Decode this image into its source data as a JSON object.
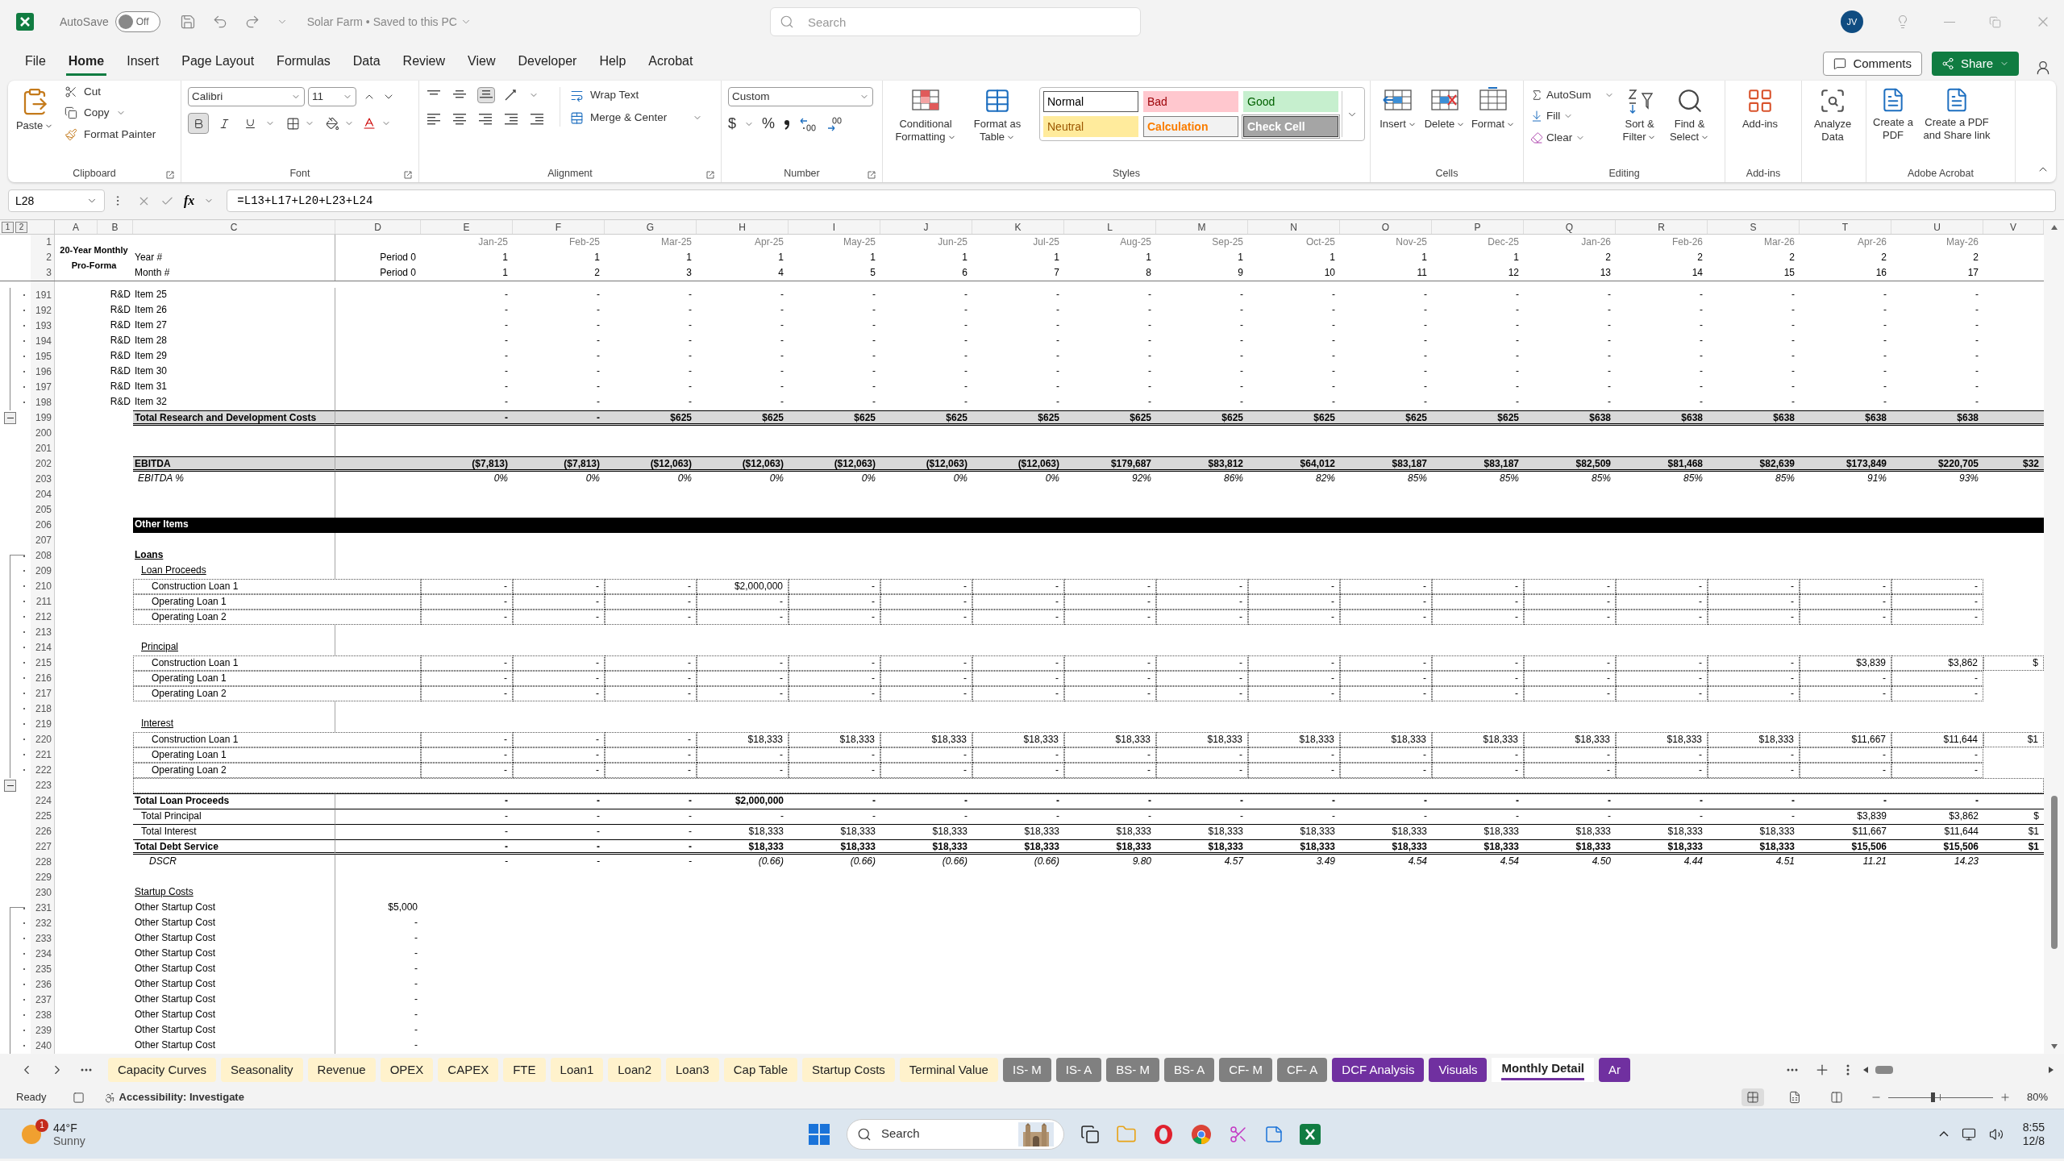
{
  "title_bar": {
    "autosave": {
      "label": "AutoSave",
      "state_text": "Off",
      "on": false
    },
    "document": "Solar Farm • Saved to this PC",
    "search": {
      "placeholder": "Search"
    },
    "avatar": "JV"
  },
  "menu": {
    "tabs": [
      {
        "label": "File",
        "selected": false
      },
      {
        "label": "Home",
        "selected": true
      },
      {
        "label": "Insert",
        "selected": false
      },
      {
        "label": "Page Layout",
        "selected": false
      },
      {
        "label": "Formulas",
        "selected": false
      },
      {
        "label": "Data",
        "selected": false
      },
      {
        "label": "Review",
        "selected": false
      },
      {
        "label": "View",
        "selected": false
      },
      {
        "label": "Developer",
        "selected": false
      },
      {
        "label": "Help",
        "selected": false
      },
      {
        "label": "Acrobat",
        "selected": false
      }
    ],
    "comments": "Comments",
    "share": "Share"
  },
  "ribbon": {
    "clipboard": {
      "label": "Clipboard",
      "paste": "Paste",
      "cut": "Cut",
      "copy": "Copy",
      "format_painter": "Format Painter"
    },
    "font": {
      "label": "Font",
      "family": "Calibri",
      "size": "11",
      "bold": true,
      "italic": false,
      "underline": false
    },
    "alignment": {
      "label": "Alignment",
      "wrap": "Wrap Text",
      "merge": "Merge & Center"
    },
    "number": {
      "label": "Number",
      "format": "Custom",
      "currency": "$",
      "percent": "%"
    },
    "styles": {
      "label": "Styles",
      "conditional": "Conditional Formatting",
      "format_table": "Format as Table",
      "cells": [
        {
          "label": "Normal",
          "kind": "normal"
        },
        {
          "label": "Bad",
          "kind": "bad"
        },
        {
          "label": "Good",
          "kind": "good"
        },
        {
          "label": "Neutral",
          "kind": "neutral"
        },
        {
          "label": "Calculation",
          "kind": "calculation"
        },
        {
          "label": "Check Cell",
          "kind": "check"
        }
      ]
    },
    "cells": {
      "label": "Cells",
      "insert": "Insert",
      "delete": "Delete",
      "format": "Format"
    },
    "editing": {
      "label": "Editing",
      "autosum": "AutoSum",
      "fill": "Fill",
      "clear": "Clear",
      "sort": "Sort & Filter",
      "find": "Find & Select"
    },
    "addins": {
      "label": "Add-ins",
      "button": "Add-ins"
    },
    "analyze": {
      "button": "Analyze Data"
    },
    "acrobat": {
      "label": "Adobe Acrobat",
      "create": "Create a PDF",
      "share": "Create a PDF and Share link"
    }
  },
  "formula_bar": {
    "name_box": "L28",
    "fx": "fx",
    "formula": "=L13+L17+L20+L23+L24"
  },
  "sheet": {
    "outline_levels": [
      "1",
      "2"
    ],
    "columns": [
      "A",
      "B",
      "C",
      "D",
      "E",
      "F",
      "G",
      "H",
      "I",
      "J",
      "K",
      "L",
      "M",
      "N",
      "O",
      "P",
      "Q",
      "R",
      "S",
      "T",
      "U",
      "V"
    ],
    "title": "20-Year Monthly Pro-Forma",
    "header_rows": [
      {
        "num": "1",
        "v": [
          "Jan-25",
          "Feb-25",
          "Mar-25",
          "Apr-25",
          "May-25",
          "Jun-25",
          "Jul-25",
          "Aug-25",
          "Sep-25",
          "Oct-25",
          "Nov-25",
          "Dec-25",
          "Jan-26",
          "Feb-26",
          "Mar-26",
          "Apr-26",
          "May-26"
        ]
      },
      {
        "num": "2",
        "label": "Year #",
        "d": "Period 0",
        "v": [
          "1",
          "1",
          "1",
          "1",
          "1",
          "1",
          "1",
          "1",
          "1",
          "1",
          "1",
          "1",
          "2",
          "2",
          "2",
          "2",
          "2"
        ]
      },
      {
        "num": "3",
        "label": "Month #",
        "d": "Period 0",
        "v": [
          "1",
          "2",
          "3",
          "4",
          "5",
          "6",
          "7",
          "8",
          "9",
          "10",
          "11",
          "12",
          "13",
          "14",
          "15",
          "16",
          "17"
        ]
      }
    ],
    "rows": [
      {
        "num": "191",
        "kind": "item",
        "grouped": true,
        "b": "R&D",
        "c": "Item 25",
        "v": [
          "-",
          "-",
          "-",
          "-",
          "-",
          "-",
          "-",
          "-",
          "-",
          "-",
          "-",
          "-",
          "-",
          "-",
          "-",
          "-",
          "-"
        ]
      },
      {
        "num": "192",
        "kind": "item",
        "grouped": true,
        "b": "R&D",
        "c": "Item 26",
        "v": [
          "-",
          "-",
          "-",
          "-",
          "-",
          "-",
          "-",
          "-",
          "-",
          "-",
          "-",
          "-",
          "-",
          "-",
          "-",
          "-",
          "-"
        ]
      },
      {
        "num": "193",
        "kind": "item",
        "grouped": true,
        "b": "R&D",
        "c": "Item 27",
        "v": [
          "-",
          "-",
          "-",
          "-",
          "-",
          "-",
          "-",
          "-",
          "-",
          "-",
          "-",
          "-",
          "-",
          "-",
          "-",
          "-",
          "-"
        ]
      },
      {
        "num": "194",
        "kind": "item",
        "grouped": true,
        "b": "R&D",
        "c": "Item 28",
        "v": [
          "-",
          "-",
          "-",
          "-",
          "-",
          "-",
          "-",
          "-",
          "-",
          "-",
          "-",
          "-",
          "-",
          "-",
          "-",
          "-",
          "-"
        ]
      },
      {
        "num": "195",
        "kind": "item",
        "grouped": true,
        "b": "R&D",
        "c": "Item 29",
        "v": [
          "-",
          "-",
          "-",
          "-",
          "-",
          "-",
          "-",
          "-",
          "-",
          "-",
          "-",
          "-",
          "-",
          "-",
          "-",
          "-",
          "-"
        ]
      },
      {
        "num": "196",
        "kind": "item",
        "grouped": true,
        "b": "R&D",
        "c": "Item 30",
        "v": [
          "-",
          "-",
          "-",
          "-",
          "-",
          "-",
          "-",
          "-",
          "-",
          "-",
          "-",
          "-",
          "-",
          "-",
          "-",
          "-",
          "-"
        ]
      },
      {
        "num": "197",
        "kind": "item",
        "grouped": true,
        "b": "R&D",
        "c": "Item 31",
        "v": [
          "-",
          "-",
          "-",
          "-",
          "-",
          "-",
          "-",
          "-",
          "-",
          "-",
          "-",
          "-",
          "-",
          "-",
          "-",
          "-",
          "-"
        ]
      },
      {
        "num": "198",
        "kind": "item",
        "grouped": true,
        "b": "R&D",
        "c": "Item 32",
        "v": [
          "-",
          "-",
          "-",
          "-",
          "-",
          "-",
          "-",
          "-",
          "-",
          "-",
          "-",
          "-",
          "-",
          "-",
          "-",
          "-",
          "-"
        ]
      },
      {
        "num": "199",
        "kind": "total",
        "collapsible": true,
        "c": "Total Research and Development Costs",
        "v": [
          "-",
          "-",
          "$625",
          "$625",
          "$625",
          "$625",
          "$625",
          "$625",
          "$625",
          "$625",
          "$625",
          "$625",
          "$638",
          "$638",
          "$638",
          "$638",
          "$638"
        ]
      },
      {
        "num": "200",
        "kind": "blank"
      },
      {
        "num": "201",
        "kind": "blank"
      },
      {
        "num": "202",
        "kind": "total",
        "c": "EBITDA",
        "v": [
          "($7,813)",
          "($7,813)",
          "($12,063)",
          "($12,063)",
          "($12,063)",
          "($12,063)",
          "($12,063)",
          "$179,687",
          "$83,812",
          "$64,012",
          "$83,187",
          "$83,187",
          "$82,509",
          "$81,468",
          "$82,639",
          "$173,849",
          "$220,705",
          "$32"
        ]
      },
      {
        "num": "203",
        "kind": "pct",
        "c": "EBITDA %",
        "v": [
          "0%",
          "0%",
          "0%",
          "0%",
          "0%",
          "0%",
          "0%",
          "92%",
          "86%",
          "82%",
          "85%",
          "85%",
          "85%",
          "85%",
          "85%",
          "91%",
          "93%"
        ]
      },
      {
        "num": "204",
        "kind": "blank"
      },
      {
        "num": "205",
        "kind": "blank"
      },
      {
        "num": "206",
        "kind": "section",
        "c": "Other Items"
      },
      {
        "num": "207",
        "kind": "blank"
      },
      {
        "num": "208",
        "kind": "group",
        "grouped": true,
        "group_start": true,
        "c": "Loans"
      },
      {
        "num": "209",
        "kind": "subgroup",
        "grouped": true,
        "c": "Loan Proceeds"
      },
      {
        "num": "210",
        "kind": "loan",
        "grouped": true,
        "c": "Construction Loan 1",
        "v": [
          "-",
          "-",
          "-",
          "$2,000,000",
          "-",
          "-",
          "-",
          "-",
          "-",
          "-",
          "-",
          "-",
          "-",
          "-",
          "-",
          "-",
          "-"
        ]
      },
      {
        "num": "211",
        "kind": "loan",
        "grouped": true,
        "c": "Operating Loan 1",
        "v": [
          "-",
          "-",
          "-",
          "-",
          "-",
          "-",
          "-",
          "-",
          "-",
          "-",
          "-",
          "-",
          "-",
          "-",
          "-",
          "-",
          "-"
        ]
      },
      {
        "num": "212",
        "kind": "loan",
        "grouped": true,
        "c": "Operating Loan 2",
        "v": [
          "-",
          "-",
          "-",
          "-",
          "-",
          "-",
          "-",
          "-",
          "-",
          "-",
          "-",
          "-",
          "-",
          "-",
          "-",
          "-",
          "-"
        ]
      },
      {
        "num": "213",
        "kind": "blank",
        "grouped": true
      },
      {
        "num": "214",
        "kind": "subgroup",
        "grouped": true,
        "c": "Principal"
      },
      {
        "num": "215",
        "kind": "loan",
        "grouped": true,
        "c": "Construction Loan 1",
        "v": [
          "-",
          "-",
          "-",
          "-",
          "-",
          "-",
          "-",
          "-",
          "-",
          "-",
          "-",
          "-",
          "-",
          "-",
          "-",
          "$3,839",
          "$3,862",
          "$"
        ]
      },
      {
        "num": "216",
        "kind": "loan",
        "grouped": true,
        "c": "Operating Loan 1",
        "v": [
          "-",
          "-",
          "-",
          "-",
          "-",
          "-",
          "-",
          "-",
          "-",
          "-",
          "-",
          "-",
          "-",
          "-",
          "-",
          "-",
          "-"
        ]
      },
      {
        "num": "217",
        "kind": "loan",
        "grouped": true,
        "c": "Operating Loan 2",
        "v": [
          "-",
          "-",
          "-",
          "-",
          "-",
          "-",
          "-",
          "-",
          "-",
          "-",
          "-",
          "-",
          "-",
          "-",
          "-",
          "-",
          "-"
        ]
      },
      {
        "num": "218",
        "kind": "blank",
        "grouped": true
      },
      {
        "num": "219",
        "kind": "subgroup",
        "grouped": true,
        "c": "Interest"
      },
      {
        "num": "220",
        "kind": "loan",
        "grouped": true,
        "c": "Construction Loan 1",
        "v": [
          "-",
          "-",
          "-",
          "$18,333",
          "$18,333",
          "$18,333",
          "$18,333",
          "$18,333",
          "$18,333",
          "$18,333",
          "$18,333",
          "$18,333",
          "$18,333",
          "$18,333",
          "$18,333",
          "$11,667",
          "$11,644",
          "$1"
        ]
      },
      {
        "num": "221",
        "kind": "loan",
        "grouped": true,
        "c": "Operating Loan 1",
        "v": [
          "-",
          "-",
          "-",
          "-",
          "-",
          "-",
          "-",
          "-",
          "-",
          "-",
          "-",
          "-",
          "-",
          "-",
          "-",
          "-",
          "-"
        ]
      },
      {
        "num": "222",
        "kind": "loan",
        "grouped": true,
        "c": "Operating Loan 2",
        "v": [
          "-",
          "-",
          "-",
          "-",
          "-",
          "-",
          "-",
          "-",
          "-",
          "-",
          "-",
          "-",
          "-",
          "-",
          "-",
          "-",
          "-"
        ]
      },
      {
        "num": "223",
        "kind": "boxed",
        "collapsible": true
      },
      {
        "num": "224",
        "kind": "sum_strong",
        "c": "Total Loan Proceeds",
        "v": [
          "-",
          "-",
          "-",
          "$2,000,000",
          "-",
          "-",
          "-",
          "-",
          "-",
          "-",
          "-",
          "-",
          "-",
          "-",
          "-",
          "-",
          "-"
        ]
      },
      {
        "num": "225",
        "kind": "sum",
        "c": "Total Principal",
        "v": [
          "-",
          "-",
          "-",
          "-",
          "-",
          "-",
          "-",
          "-",
          "-",
          "-",
          "-",
          "-",
          "-",
          "-",
          "-",
          "$3,839",
          "$3,862",
          "$"
        ]
      },
      {
        "num": "226",
        "kind": "sum",
        "c": "Total Interest",
        "v": [
          "-",
          "-",
          "-",
          "$18,333",
          "$18,333",
          "$18,333",
          "$18,333",
          "$18,333",
          "$18,333",
          "$18,333",
          "$18,333",
          "$18,333",
          "$18,333",
          "$18,333",
          "$18,333",
          "$11,667",
          "$11,644",
          "$1"
        ]
      },
      {
        "num": "227",
        "kind": "grand",
        "c": "Total Debt Service",
        "v": [
          "-",
          "-",
          "-",
          "$18,333",
          "$18,333",
          "$18,333",
          "$18,333",
          "$18,333",
          "$18,333",
          "$18,333",
          "$18,333",
          "$18,333",
          "$18,333",
          "$18,333",
          "$18,333",
          "$15,506",
          "$15,506",
          "$1"
        ]
      },
      {
        "num": "228",
        "kind": "ratio",
        "c": "DSCR",
        "v": [
          "-",
          "-",
          "-",
          "(0.66)",
          "(0.66)",
          "(0.66)",
          "(0.66)",
          "9.80",
          "4.57",
          "3.49",
          "4.54",
          "4.54",
          "4.50",
          "4.44",
          "4.51",
          "11.21",
          "14.23"
        ]
      },
      {
        "num": "229",
        "kind": "blank"
      },
      {
        "num": "230",
        "kind": "caption",
        "c": "Startup Costs"
      },
      {
        "num": "231",
        "kind": "startup",
        "grouped": true,
        "group_start": true,
        "c": "Other Startup Cost",
        "d": "$5,000"
      },
      {
        "num": "232",
        "kind": "startup",
        "grouped": true,
        "c": "Other Startup Cost",
        "d": "-"
      },
      {
        "num": "233",
        "kind": "startup",
        "grouped": true,
        "c": "Other Startup Cost",
        "d": "-"
      },
      {
        "num": "234",
        "kind": "startup",
        "grouped": true,
        "c": "Other Startup Cost",
        "d": "-"
      },
      {
        "num": "235",
        "kind": "startup",
        "grouped": true,
        "c": "Other Startup Cost",
        "d": "-"
      },
      {
        "num": "236",
        "kind": "startup",
        "grouped": true,
        "c": "Other Startup Cost",
        "d": "-"
      },
      {
        "num": "237",
        "kind": "startup",
        "grouped": true,
        "c": "Other Startup Cost",
        "d": "-"
      },
      {
        "num": "238",
        "kind": "startup",
        "grouped": true,
        "c": "Other Startup Cost",
        "d": "-"
      },
      {
        "num": "239",
        "kind": "startup",
        "grouped": true,
        "c": "Other Startup Cost",
        "d": "-"
      },
      {
        "num": "240",
        "kind": "startup",
        "grouped": true,
        "c": "Other Startup Cost",
        "d": "-"
      }
    ]
  },
  "sheet_tabs": [
    {
      "label": "Capacity Curves",
      "color": "#fff2cc",
      "selected": false
    },
    {
      "label": "Seasonality",
      "color": "#fff2cc",
      "selected": false
    },
    {
      "label": "Revenue",
      "color": "#fff2cc",
      "selected": false
    },
    {
      "label": "OPEX",
      "color": "#fff2cc",
      "selected": false
    },
    {
      "label": "CAPEX",
      "color": "#fff2cc",
      "selected": false
    },
    {
      "label": "FTE",
      "color": "#fff2cc",
      "selected": false
    },
    {
      "label": "Loan1",
      "color": "#fff2cc",
      "selected": false
    },
    {
      "label": "Loan2",
      "color": "#fff2cc",
      "selected": false
    },
    {
      "label": "Loan3",
      "color": "#fff2cc",
      "selected": false
    },
    {
      "label": "Cap Table",
      "color": "#fff2cc",
      "selected": false
    },
    {
      "label": "Startup Costs",
      "color": "#fff2cc",
      "selected": false
    },
    {
      "label": "Terminal Value",
      "color": "#fff2cc",
      "selected": false
    },
    {
      "label": "IS- M",
      "color": "#808080",
      "selected": false
    },
    {
      "label": "IS- A",
      "color": "#808080",
      "selected": false
    },
    {
      "label": "BS- M",
      "color": "#808080",
      "selected": false
    },
    {
      "label": "BS- A",
      "color": "#808080",
      "selected": false
    },
    {
      "label": "CF- M",
      "color": "#808080",
      "selected": false
    },
    {
      "label": "CF- A",
      "color": "#808080",
      "selected": false
    },
    {
      "label": "DCF Analysis",
      "color": "#7030a0",
      "selected": false
    },
    {
      "label": "Visuals",
      "color": "#7030a0",
      "selected": false
    },
    {
      "label": "Monthly Detail",
      "color": "#7030a0",
      "selected": true
    },
    {
      "label": "Ar",
      "color": "#7030a0",
      "selected": false
    }
  ],
  "status_bar": {
    "ready": "Ready",
    "accessibility": "Accessibility: Investigate",
    "views": [
      {
        "kind": "normal",
        "selected": true
      },
      {
        "kind": "page_layout",
        "selected": false
      },
      {
        "kind": "page_break",
        "selected": false
      }
    ],
    "zoom": {
      "text": "80%",
      "level": 0.42
    }
  },
  "taskbar": {
    "weather": {
      "temp": "44°F",
      "condition": "Sunny",
      "badge": "1"
    },
    "search": {
      "placeholder": "Search"
    },
    "clock": {
      "time": "8:55",
      "date": "12/8"
    }
  }
}
